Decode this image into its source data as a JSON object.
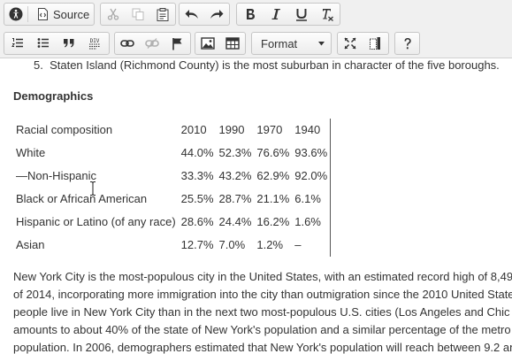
{
  "toolbar": {
    "source_label": "Source",
    "format_label": "Format"
  },
  "content": {
    "list_item_number": "5.",
    "list_item_text": "Staten Island (Richmond County) is the most suburban in character of the five boroughs.",
    "heading": "Demographics",
    "table": {
      "header": [
        "Racial composition",
        "2010",
        "1990",
        "1970",
        "1940"
      ],
      "rows": [
        [
          "White",
          "44.0%",
          "52.3%",
          "76.6%",
          "93.6%"
        ],
        [
          "—Non-Hispanic",
          "33.3%",
          "43.2%",
          "62.9%",
          "92.0%"
        ],
        [
          "Black or African American",
          "25.5%",
          "28.7%",
          "21.1%",
          "6.1%"
        ],
        [
          "Hispanic or Latino (of any race)",
          "28.6%",
          "24.4%",
          "16.2%",
          "1.6%"
        ],
        [
          "Asian",
          "12.7%",
          "7.0%",
          "1.2%",
          "–"
        ]
      ]
    },
    "paragraph_lines": [
      "New York City is the most-populous city in the United States, with an estimated record high of 8,49",
      "of 2014, incorporating more immigration into the city than outmigration since the 2010 United State",
      "people live in New York City than in the next two most-populous U.S. cities (Los Angeles and Chic",
      "amounts to about 40% of the state of New York's population and a similar percentage of the metro",
      "population. In 2006, demographers estimated that New York's population will reach between 9.2 an"
    ]
  }
}
